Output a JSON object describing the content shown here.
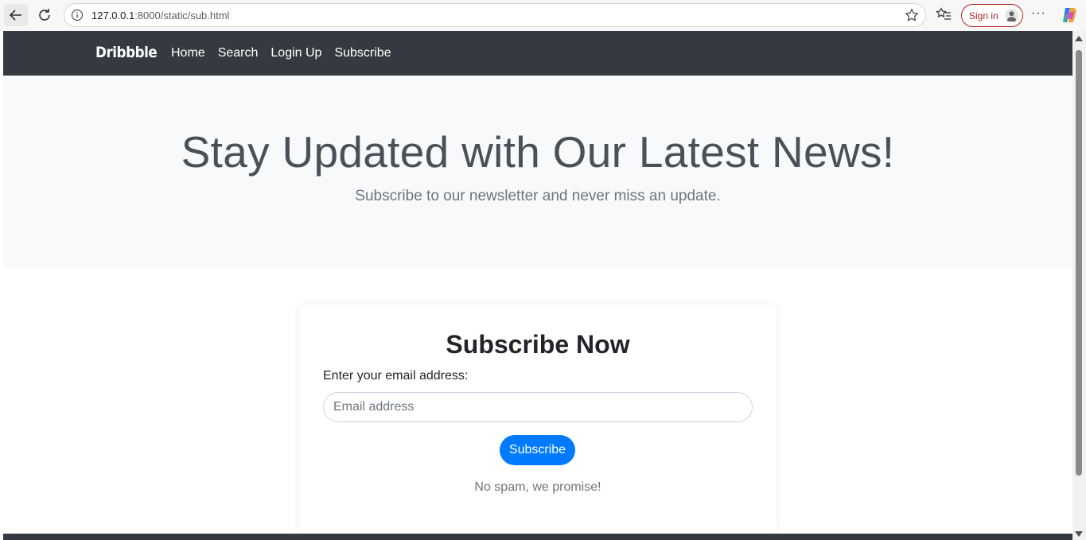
{
  "browser": {
    "url_host": "127.0.0.1",
    "url_path": ":8000/static/sub.html",
    "signin_label": "Sign in",
    "more_label": "···"
  },
  "navbar": {
    "brand": "Dribbble",
    "links": [
      "Home",
      "Search",
      "Login Up",
      "Subscribe"
    ]
  },
  "hero": {
    "title": "Stay Updated with Our Latest News!",
    "subtitle": "Subscribe to our newsletter and never miss an update."
  },
  "subscribe_card": {
    "heading": "Subscribe Now",
    "email_label": "Enter your email address:",
    "email_placeholder": "Email address",
    "email_value": "",
    "button_label": "Subscribe",
    "note": "No spam, we promise!"
  },
  "colors": {
    "navbar_bg": "#343a40",
    "hero_bg": "#f8f9fa",
    "primary_button": "#007bff",
    "signin_accent": "#b3261e"
  }
}
